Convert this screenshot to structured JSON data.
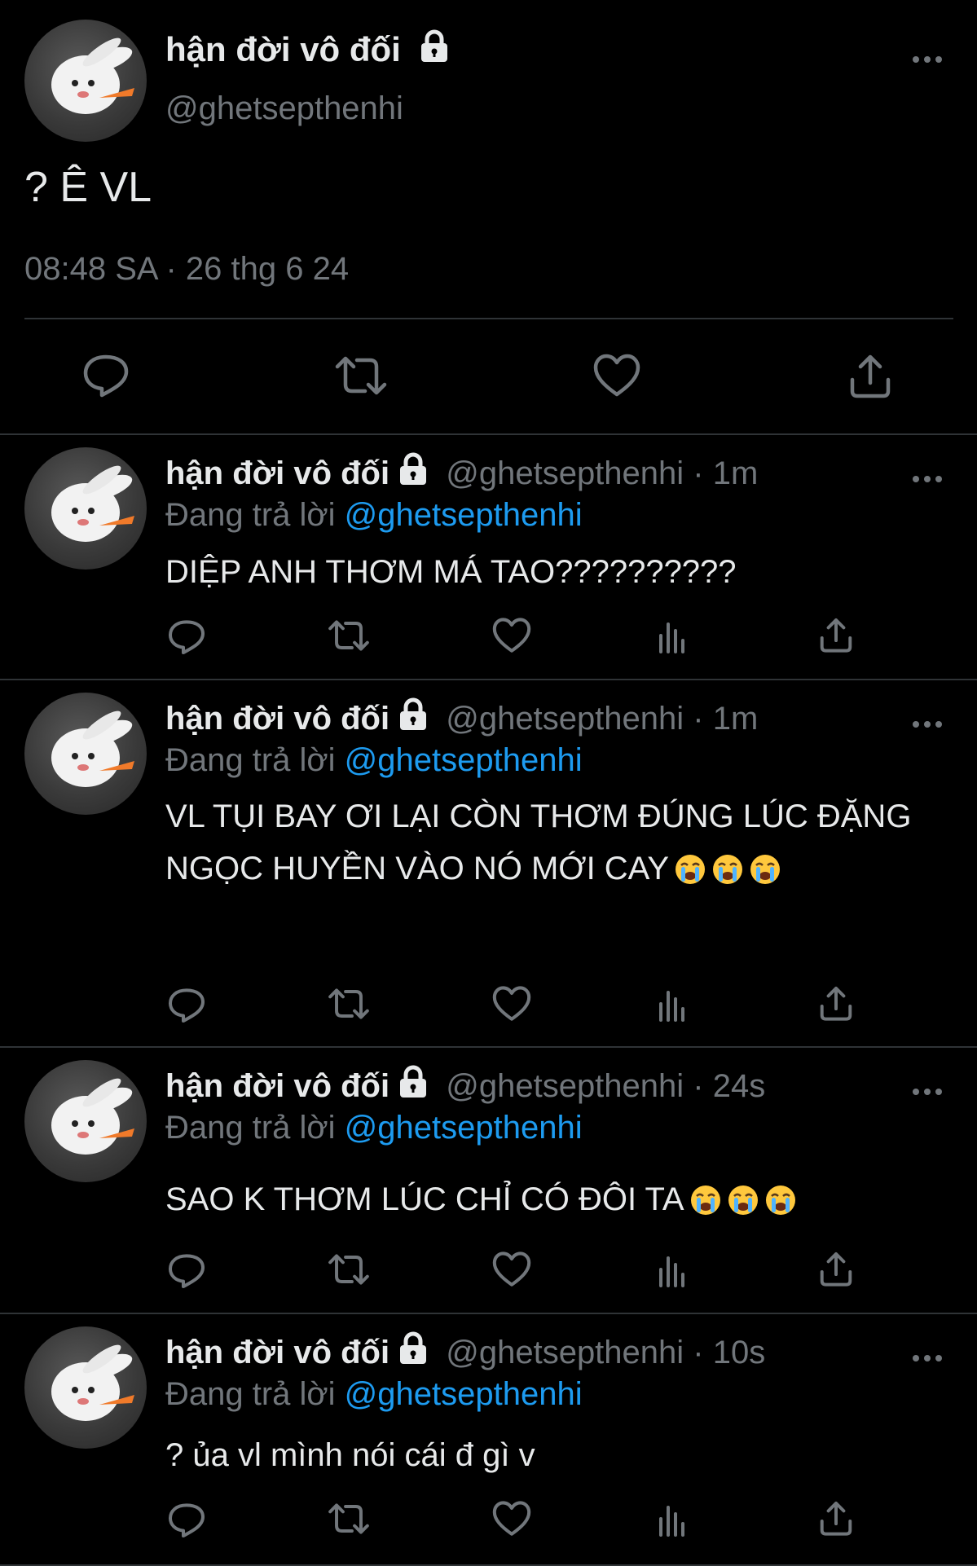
{
  "main_tweet": {
    "display_name": "hận đời vô đối",
    "handle": "@ghetsepthenhi",
    "text": "? Ê VL",
    "timestamp": "08:48 SA · 26 thg 6 24",
    "actions": [
      "reply-icon",
      "retweet-icon",
      "like-icon",
      "share-icon"
    ]
  },
  "replies": [
    {
      "display_name": "hận đời vô đối",
      "handle_time": "@ghetsepthenhi · 1m",
      "replying_label": "Đang trả lời",
      "replying_to": "@ghetsepthenhi",
      "text": "DIỆP ANH THƠM MÁ TAO??????????",
      "emoji_count": 0
    },
    {
      "display_name": "hận đời vô đối",
      "handle_time": "@ghetsepthenhi · 1m",
      "replying_label": "Đang trả lời",
      "replying_to": "@ghetsepthenhi",
      "text": "VL TỤI BAY ƠI LẠI CÒN THƠM ĐÚNG LÚC ĐẶNG NGỌC HUYỀN VÀO NÓ MỚI CAY",
      "emoji_count": 3
    },
    {
      "display_name": "hận đời vô đối",
      "handle_time": "@ghetsepthenhi · 24s",
      "replying_label": "Đang trả lời",
      "replying_to": "@ghetsepthenhi",
      "text": "SAO K THƠM LÚC CHỈ CÓ ĐÔI TA",
      "emoji_count": 3
    },
    {
      "display_name": "hận đời vô đối",
      "handle_time": "@ghetsepthenhi · 10s",
      "replying_label": "Đang trả lời",
      "replying_to": "@ghetsepthenhi",
      "text": "? ủa vl mình nói cái đ gì v",
      "emoji_count": 0
    }
  ],
  "colors": {
    "background": "#000000",
    "text": "#e7e9ea",
    "secondary": "#71767b",
    "mention": "#1d9bf0",
    "divider": "#2f3336"
  }
}
